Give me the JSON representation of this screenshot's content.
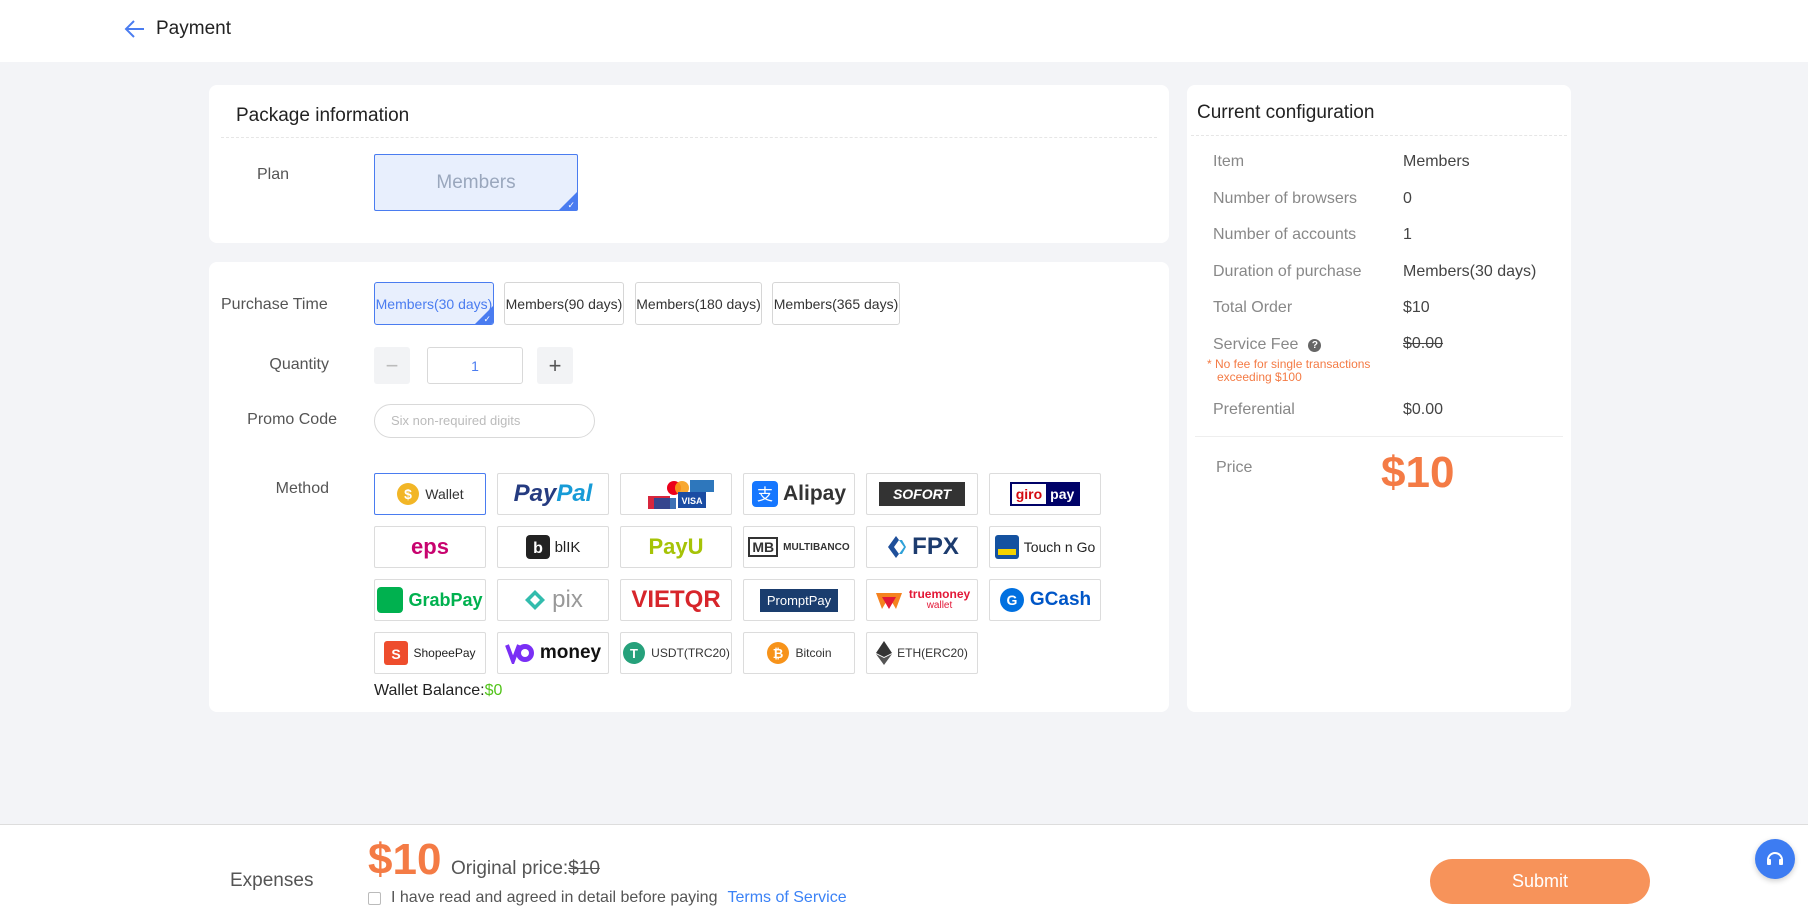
{
  "header": {
    "back_label": "Payment"
  },
  "package": {
    "title": "Package information",
    "plan_label": "Plan",
    "plan_value": "Members"
  },
  "options": {
    "purchase_time_label": "Purchase Time",
    "durations": [
      "Members(30 days)",
      "Members(90 days)",
      "Members(180 days)",
      "Members(365 days)"
    ],
    "selected_duration_index": 0,
    "quantity_label": "Quantity",
    "quantity_value": "1",
    "promo_label": "Promo Code",
    "promo_placeholder": "Six non-required digits",
    "method_label": "Method",
    "methods": {
      "wallet": "Wallet",
      "paypal_pay": "Pay",
      "paypal_pal": "Pal",
      "cards": "card-logos-icon",
      "alipay": "Alipay",
      "sofort": "SOFORT",
      "giro_a": "giro",
      "giro_b": "pay",
      "eps": "eps",
      "blik": "blIK",
      "payu": "PayU",
      "multibanco_mb": "MB",
      "multibanco": "MULTIBANCO",
      "fpx": "FPX",
      "touchngo": "Touch n Go",
      "grabpay": "GrabPay",
      "pix": "pix",
      "vietqr": "VIETQR",
      "promptpay": "PromptPay",
      "truemoney_a": "truemoney",
      "truemoney_b": "wallet",
      "gcash": "GCash",
      "shopeepay": "ShopeePay",
      "money": "money",
      "usdt": "USDT(TRC20)",
      "bitcoin": "Bitcoin",
      "eth": "ETH(ERC20)"
    },
    "selected_method": "wallet",
    "wallet_balance_label": "Wallet Balance:",
    "wallet_balance_value": "$0"
  },
  "config": {
    "title": "Current configuration",
    "rows": [
      {
        "label": "Item",
        "value": "Members"
      },
      {
        "label": "Number of browsers",
        "value": "0"
      },
      {
        "label": "Number of accounts",
        "value": "1"
      },
      {
        "label": "Duration of purchase",
        "value": "Members(30 days)"
      },
      {
        "label": "Total Order",
        "value": "$10"
      },
      {
        "label": "Service Fee",
        "value": "$0.00"
      },
      {
        "label": "Preferential",
        "value": "$0.00"
      }
    ],
    "fee_note_line1": "* No fee for single transactions",
    "fee_note_line2": "exceeding $100",
    "price_label": "Price",
    "price_value": "$10"
  },
  "footer": {
    "expenses_label": "Expenses",
    "price": "$10",
    "original_label": "Original price:",
    "original_value": "$10",
    "agree_text": "I have read and agreed in detail before paying",
    "tos_link": "Terms of Service",
    "submit_label": "Submit"
  },
  "colors": {
    "accent_blue": "#4a7cf0",
    "price_orange": "#f47b45",
    "submit_orange": "#f7935a",
    "background": "#f3f4f7"
  }
}
